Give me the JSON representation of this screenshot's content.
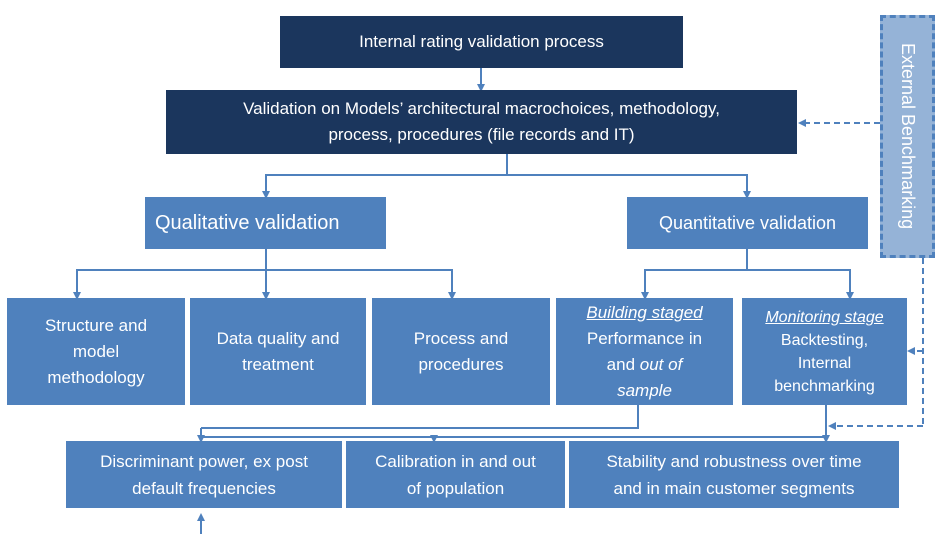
{
  "diagram": {
    "root": {
      "label": "Internal rating validation process"
    },
    "macro": {
      "line1": "Validation on Models’ architectural macrochoices, methodology,",
      "line2": "process, procedures (file records and IT)"
    },
    "external": {
      "label": "External Benchmarking"
    },
    "qualitative": {
      "label": "Qualitative validation",
      "children": [
        {
          "line1": "Structure and",
          "line2": "model",
          "line3": "methodology"
        },
        {
          "line1": "Data quality and",
          "line2": "treatment"
        },
        {
          "line1": "Process and",
          "line2": "procedures"
        }
      ]
    },
    "quantitative": {
      "label": "Quantitative validation",
      "children": [
        {
          "heading": "Building staged",
          "line1": "Performance in",
          "line2a": "and ",
          "line2b": "out of",
          "line3": "sample"
        },
        {
          "heading": "Monitoring stage",
          "line1": "Backtesting,",
          "line2": "Internal",
          "line3": "benchmarking"
        }
      ]
    },
    "outcomes": [
      {
        "line1": "Discriminant power, ex post",
        "line2": "default frequencies"
      },
      {
        "line1": "Calibration in and out",
        "line2": "of population"
      },
      {
        "line1": "Stability and robustness over time",
        "line2": "and in main customer segments"
      }
    ]
  }
}
